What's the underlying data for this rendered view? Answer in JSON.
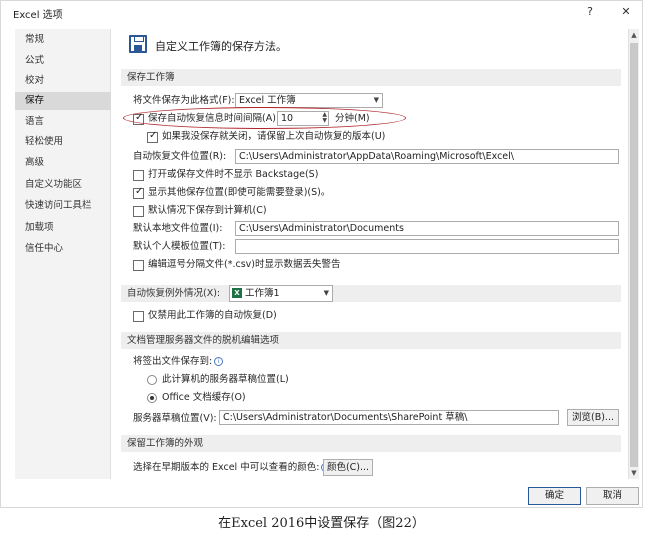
{
  "window": {
    "title": "Excel 选项",
    "help_label": "?",
    "close_label": "✕"
  },
  "nav": {
    "items": [
      {
        "label": "常规"
      },
      {
        "label": "公式"
      },
      {
        "label": "校对"
      },
      {
        "label": "保存",
        "selected": true
      },
      {
        "label": "语言"
      },
      {
        "label": "轻松使用"
      },
      {
        "label": "高级"
      },
      {
        "label": "自定义功能区"
      },
      {
        "label": "快速访问工具栏"
      },
      {
        "label": "加载项"
      },
      {
        "label": "信任中心"
      }
    ]
  },
  "header": {
    "icon": "save-icon",
    "text": "自定义工作簿的保存方法。"
  },
  "sections": {
    "save_workbooks": "保存工作簿",
    "autorecover_exceptions": "自动恢复例外情况(X):",
    "offline_editing": "文档管理服务器文件的脱机编辑选项",
    "preserve_visual": "保留工作簿的外观"
  },
  "save": {
    "format_label": "将文件保存为此格式(F):",
    "format_value": "Excel 工作簿",
    "autorecover_label": "保存自动恢复信息时间间隔(A)",
    "autorecover_checked": true,
    "autorecover_minutes": "10",
    "minutes_label": "分钟(M)",
    "keep_last_label": "如果我没保存就关闭，请保留上次自动恢复的版本(U)",
    "keep_last_checked": true,
    "autorecover_location_label": "自动恢复文件位置(R):",
    "autorecover_location_value": "C:\\Users\\Administrator\\AppData\\Roaming\\Microsoft\\Excel\\",
    "no_backstage_label": "打开或保存文件时不显示 Backstage(S)",
    "no_backstage_checked": false,
    "show_additional_label": "显示其他保存位置(即使可能需要登录)(S)。",
    "show_additional_checked": true,
    "default_computer_label": "默认情况下保存到计算机(C)",
    "default_computer_checked": false,
    "default_local_label": "默认本地文件位置(I):",
    "default_local_value": "C:\\Users\\Administrator\\Documents",
    "personal_templates_label": "默认个人模板位置(T):",
    "personal_templates_value": "",
    "csv_warning_label": "编辑逗号分隔文件(*.csv)时显示数据丢失警告",
    "csv_warning_checked": false
  },
  "autorecover_exceptions": {
    "workbook_value": "工作簿1",
    "workbook_icon": "excel-icon",
    "disable_label": "仅禁用此工作簿的自动恢复(D)",
    "disable_checked": false
  },
  "offline": {
    "checkout_label": "将签出文件保存到:",
    "server_drafts_label": "此计算机的服务器草稿位置(L)",
    "server_drafts_selected": false,
    "office_cache_label": "Office 文档缓存(O)",
    "office_cache_selected": true,
    "drafts_location_label": "服务器草稿位置(V):",
    "drafts_location_value": "C:\\Users\\Administrator\\Documents\\SharePoint 草稿\\",
    "browse_label": "浏览(B)..."
  },
  "visual": {
    "colors_label": "选择在早期版本的 Excel 中可以查看的颜色:",
    "colors_button": "颜色(C)..."
  },
  "footer": {
    "ok_label": "确定",
    "cancel_label": "取消"
  },
  "caption": "在Excel 2016中设置保存（图22）",
  "colors": {
    "accent": "#2b5797",
    "annotation_oval": "#b0262b",
    "excel_green": "#1e7145"
  }
}
